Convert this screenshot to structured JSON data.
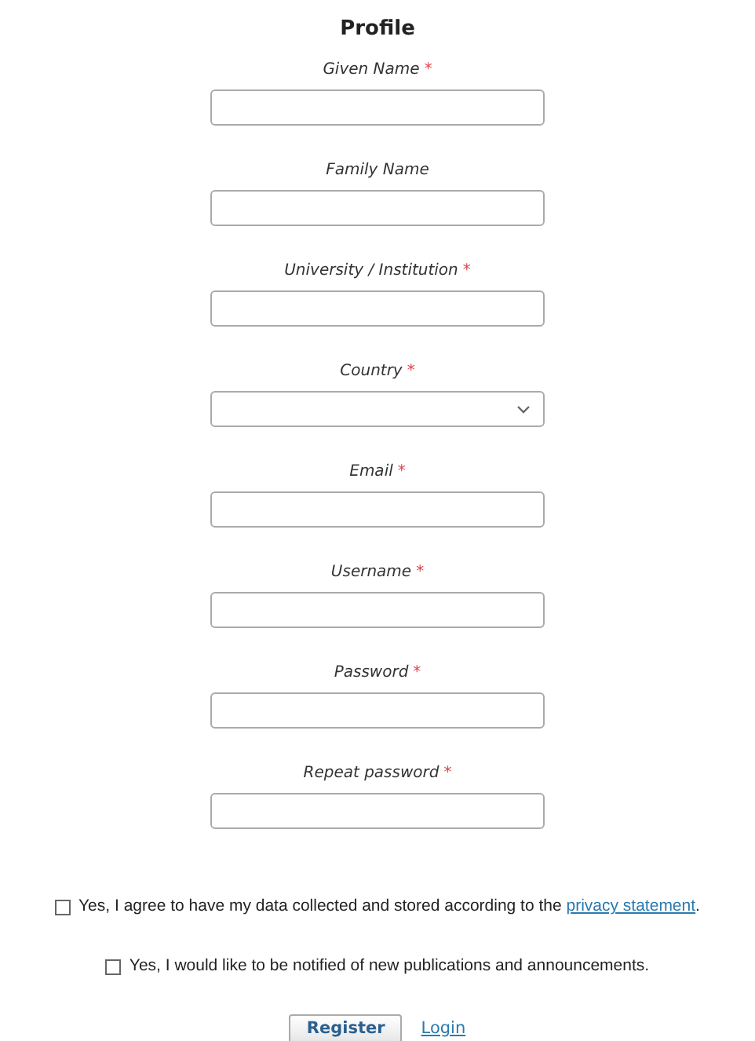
{
  "title": "Profile",
  "fields": [
    {
      "label": "Given Name",
      "required_mark": "*",
      "kind": "text"
    },
    {
      "label": "Family Name",
      "kind": "text"
    },
    {
      "label": "University / Institution",
      "required_mark": "*",
      "kind": "text"
    },
    {
      "label": "Country",
      "required_mark": "*",
      "kind": "select"
    },
    {
      "label": "Email",
      "required_mark": "*",
      "kind": "text"
    },
    {
      "label": "Username",
      "required_mark": "*",
      "kind": "text"
    },
    {
      "label": "Password",
      "required_mark": "*",
      "kind": "text"
    },
    {
      "label": "Repeat password",
      "required_mark": "*",
      "kind": "text"
    }
  ],
  "consents": [
    {
      "text": "Yes, I agree to have my data collected and stored according to the",
      "link": "privacy statement",
      "after": ".",
      "checked": false
    },
    {
      "text": "Yes, I would like to be notified of new publications and announcements.",
      "checked": false
    }
  ],
  "buttons": {
    "register": "Register",
    "login": "Login"
  }
}
